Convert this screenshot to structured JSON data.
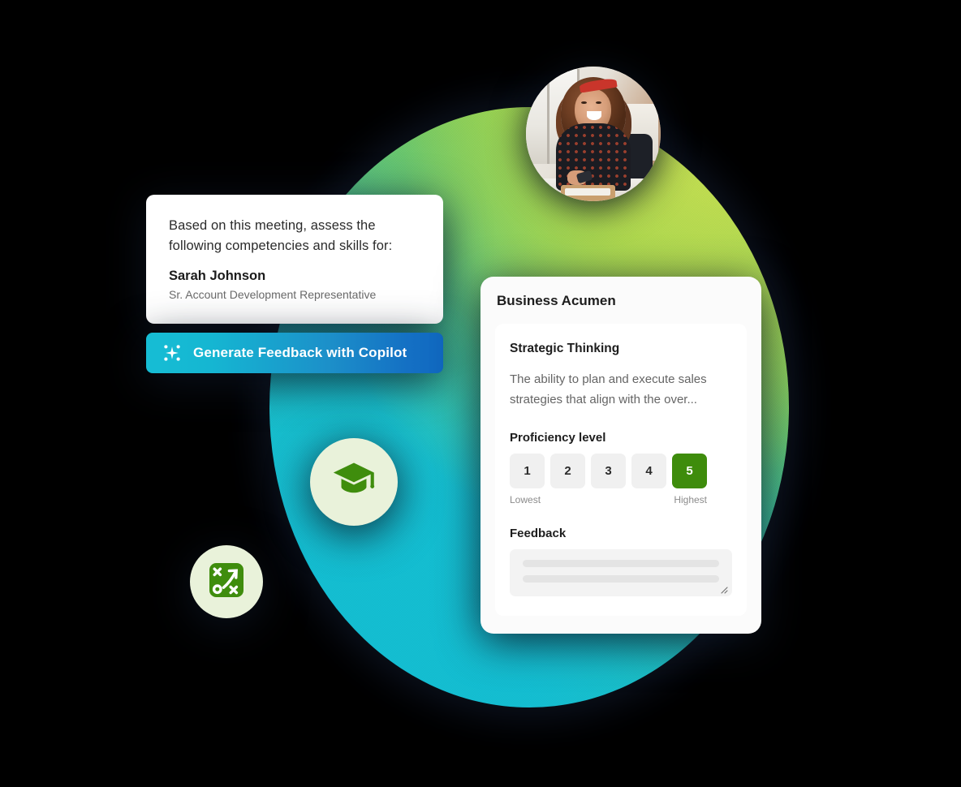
{
  "prompt_card": {
    "lead": "Based on this meeting, assess the following competencies and skills for:",
    "person_name": "Sarah Johnson",
    "person_role": "Sr. Account Development Representative"
  },
  "copilot_button": {
    "label": "Generate Feedback with Copilot",
    "icon": "copilot-sparkle-icon",
    "gradient_from": "#16bdd4",
    "gradient_to": "#1068c0"
  },
  "badges": [
    {
      "name": "graduation-cap-icon",
      "color": "#3e8c0c",
      "background": "#e9f2da"
    },
    {
      "name": "strategy-playbook-icon",
      "color": "#3e8c0c",
      "background": "#e9f2da"
    }
  ],
  "avatar": {
    "name": "sarah-johnson-avatar",
    "alt": "Smiling woman with curly hair holding a phone at an office desk"
  },
  "competency_card": {
    "title": "Business Acumen",
    "skill_title": "Strategic Thinking",
    "skill_description": "The ability to plan and execute sales strategies that align with the over...",
    "proficiency": {
      "label": "Proficiency level",
      "options": [
        "1",
        "2",
        "3",
        "4",
        "5"
      ],
      "selected": "5",
      "selected_color": "#3e8c0c",
      "low_label": "Lowest",
      "high_label": "Highest"
    },
    "feedback": {
      "label": "Feedback",
      "value": "",
      "placeholder": ""
    }
  },
  "blob": {
    "name": "gradient-blob",
    "colors": [
      "#bcdb4f",
      "#8ccd49",
      "#5ec06d",
      "#35bfa2",
      "#13bcd0"
    ]
  }
}
